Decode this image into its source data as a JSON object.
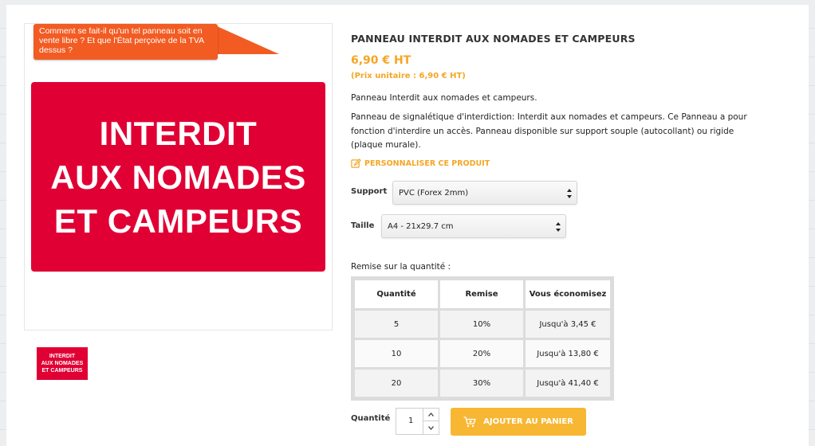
{
  "product": {
    "title": "PANNEAU INTERDIT AUX NOMADES ET CAMPEURS",
    "price": "6,90 € HT",
    "unit_price": "(Prix unitaire : 6,90 € HT)",
    "short_description": "Panneau Interdit aux nomades et campeurs.",
    "long_description": "Panneau de signalétique d'interdiction: Interdit aux nomades et campeurs. Ce Panneau a pour fonction d'interdire un accès. Panneau disponible sur support souple (autocollant) ou rigide (plaque murale).",
    "customize_label": "PERSONNALISER CE PRODUIT",
    "customize_icon": "edit-pencil-icon"
  },
  "image": {
    "sign_lines": [
      "INTERDIT",
      "AUX NOMADES",
      "ET CAMPEURS"
    ],
    "sign_color": "#e00034",
    "annotation": "Comment se fait-il qu'un tel panneau soit en vente libre ? Et que l'État perçoive de la TVA dessus ?",
    "annotation_color": "#f25c23",
    "thumbnail_lines": [
      "INTERDIT",
      "AUX NOMADES",
      "ET CAMPEURS"
    ]
  },
  "options": {
    "support_label": "Support",
    "support_value": "PVC (Forex 2mm)",
    "taille_label": "Taille",
    "taille_value": "A4 - 21x29.7 cm"
  },
  "discount": {
    "heading": "Remise sur la quantité :",
    "headers": [
      "Quantité",
      "Remise",
      "Vous économisez"
    ],
    "rows": [
      [
        "5",
        "10%",
        "Jusqu'à 3,45 €"
      ],
      [
        "10",
        "20%",
        "Jusqu'à 13,80 €"
      ],
      [
        "20",
        "30%",
        "Jusqu'à 41,40 €"
      ]
    ]
  },
  "cart": {
    "quantity_label": "Quantité",
    "quantity_value": "1",
    "add_label": "AJOUTER AU PANIER",
    "cart_icon": "shopping-cart-icon",
    "button_color": "#f7b733"
  },
  "colors": {
    "accent": "#f5a623"
  }
}
